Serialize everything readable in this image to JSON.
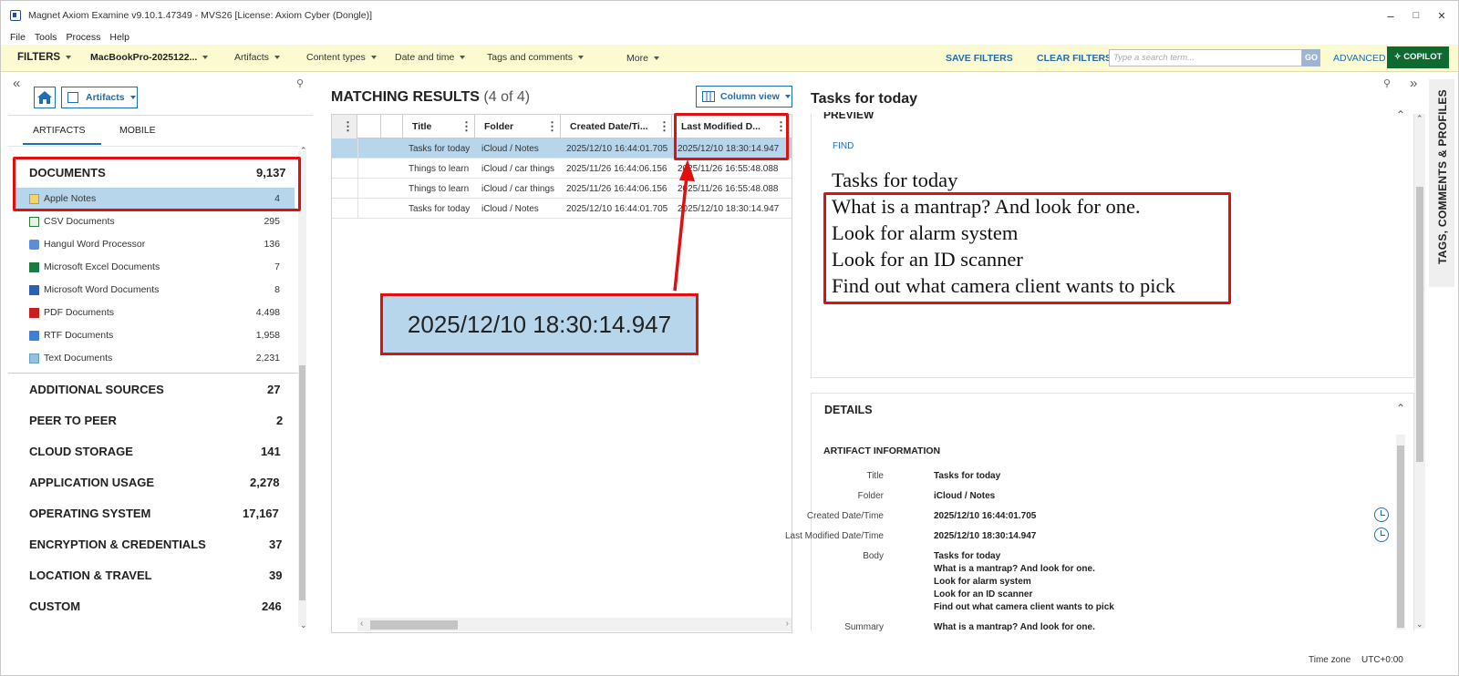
{
  "window": {
    "title": "Magnet Axiom Examine v9.10.1.47349 - MVS26   [License: Axiom Cyber (Dongle)]",
    "minimize": "–",
    "maximize": "□",
    "close": "✕"
  },
  "menu": [
    "File",
    "Tools",
    "Process",
    "Help"
  ],
  "filters": {
    "label": "FILTERS",
    "source": "MacBookPro-2025122...",
    "artifacts": "Artifacts",
    "content_types": "Content types",
    "date_time": "Date and time",
    "tags": "Tags and comments",
    "more": "More",
    "save": "SAVE FILTERS",
    "clear": "CLEAR FILTERS",
    "search_placeholder": "Type a search term...",
    "go": "GO",
    "advanced": "ADVANCED",
    "copilot": "COPILOT"
  },
  "left": {
    "view_dropdown": "Artifacts",
    "tabs": [
      "ARTIFACTS",
      "MOBILE"
    ],
    "documents": {
      "label": "DOCUMENTS",
      "count": "9,137"
    },
    "doc_items": [
      {
        "label": "Apple Notes",
        "count": "4",
        "icon": "notes-icon"
      },
      {
        "label": "CSV Documents",
        "count": "295",
        "icon": "csv-icon"
      },
      {
        "label": "Hangul Word Processor",
        "count": "136",
        "icon": "hwp-icon"
      },
      {
        "label": "Microsoft Excel Documents",
        "count": "7",
        "icon": "excel-icon"
      },
      {
        "label": "Microsoft Word Documents",
        "count": "8",
        "icon": "word-icon"
      },
      {
        "label": "PDF Documents",
        "count": "4,498",
        "icon": "pdf-icon"
      },
      {
        "label": "RTF Documents",
        "count": "1,958",
        "icon": "rtf-icon"
      },
      {
        "label": "Text Documents",
        "count": "2,231",
        "icon": "text-icon"
      }
    ],
    "categories": [
      {
        "label": "ADDITIONAL SOURCES",
        "count": "27"
      },
      {
        "label": "PEER TO PEER",
        "count": "2"
      },
      {
        "label": "CLOUD STORAGE",
        "count": "141"
      },
      {
        "label": "APPLICATION USAGE",
        "count": "2,278"
      },
      {
        "label": "OPERATING SYSTEM",
        "count": "17,167"
      },
      {
        "label": "ENCRYPTION & CREDENTIALS",
        "count": "37"
      },
      {
        "label": "LOCATION & TRAVEL",
        "count": "39"
      },
      {
        "label": "CUSTOM",
        "count": "246"
      }
    ]
  },
  "results": {
    "title": "MATCHING RESULTS",
    "count": "(4 of 4)",
    "column_view": "Column view",
    "columns": [
      "Title",
      "Folder",
      "Created Date/Ti...",
      "Last Modified D..."
    ],
    "rows": [
      [
        "Tasks for today",
        "iCloud / Notes",
        "2025/12/10 16:44:01.705",
        "2025/12/10 18:30:14.947"
      ],
      [
        "Things to learn",
        "iCloud / car things",
        "2025/11/26 16:44:06.156",
        "2025/11/26 16:55:48.088"
      ],
      [
        "Things to learn",
        "iCloud / car things",
        "2025/11/26 16:44:06.156",
        "2025/11/26 16:55:48.088"
      ],
      [
        "Tasks for today",
        "iCloud / Notes",
        "2025/12/10 16:44:01.705",
        "2025/12/10 18:30:14.947"
      ]
    ],
    "zoom_callout": "2025/12/10 18:30:14.947"
  },
  "right": {
    "title": "Tasks for today",
    "side_tab": "TAGS, COMMENTS & PROFILES",
    "preview_label": "PREVIEW",
    "find": "FIND",
    "note_lines": [
      "Tasks for today",
      "What is a mantrap? And look for one.",
      "Look for alarm system",
      "Look for an ID scanner",
      "Find out what camera client wants to pick"
    ],
    "details_label": "DETAILS",
    "artifact_info": "ARTIFACT INFORMATION",
    "fields": {
      "title_label": "Title",
      "title": "Tasks for today",
      "folder_label": "Folder",
      "folder": "iCloud / Notes",
      "created_label": "Created Date/Time",
      "created": "2025/12/10 16:44:01.705",
      "modified_label": "Last Modified Date/Time",
      "modified": "2025/12/10 18:30:14.947",
      "body_label": "Body",
      "body": [
        "Tasks for today",
        "What is a mantrap? And look for one.",
        "Look for alarm system",
        "Look for an ID scanner",
        "Find out what camera client wants to pick"
      ],
      "summary_label": "Summary",
      "summary": "What is a mantrap? And look for one."
    }
  },
  "status": {
    "tz_label": "Time zone",
    "tz_value": "UTC+0:00"
  }
}
